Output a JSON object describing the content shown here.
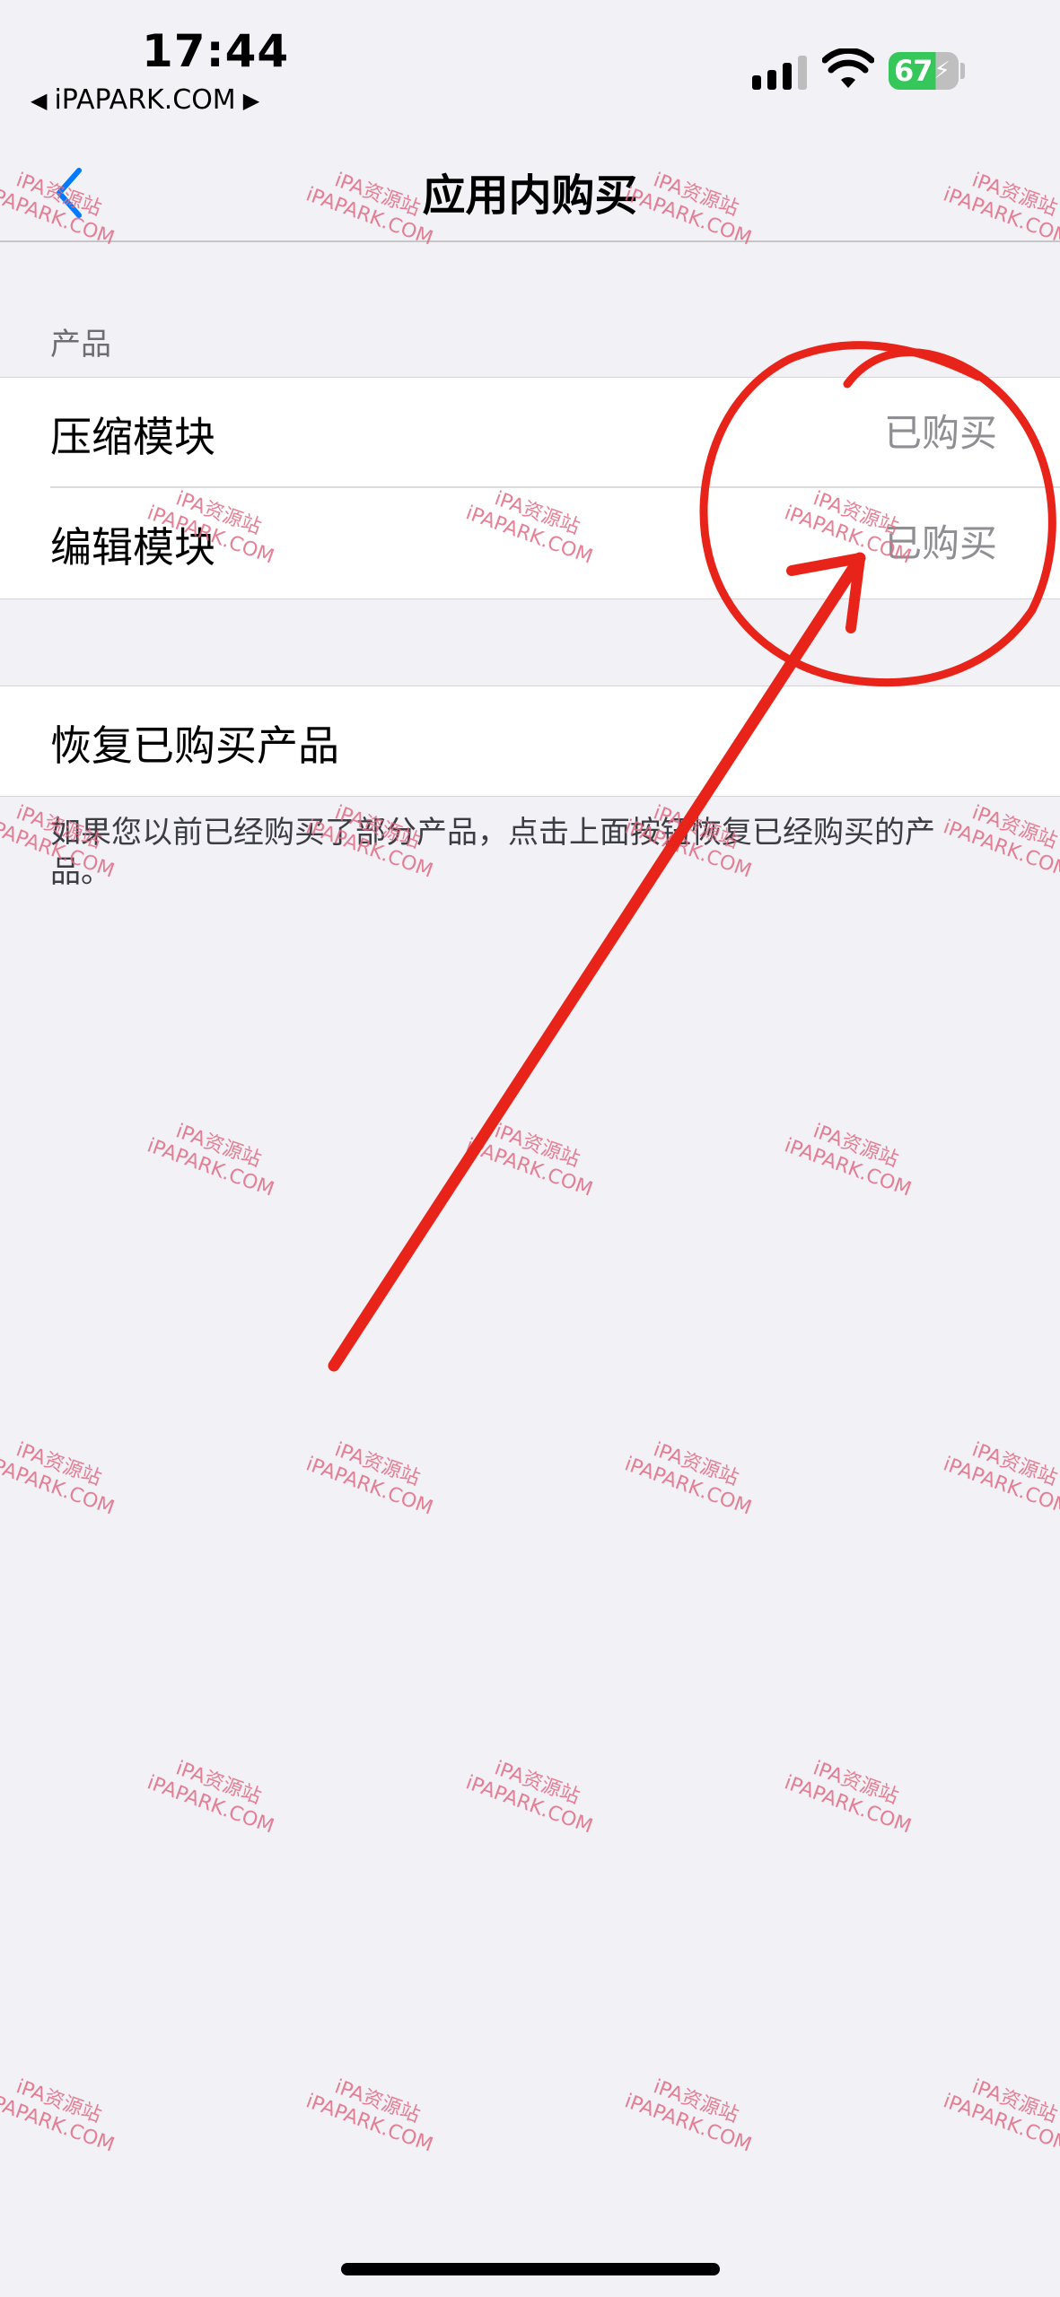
{
  "status_bar": {
    "time": "17:44",
    "back_app": "iPAPARK.COM",
    "battery_percent": "67",
    "battery_level": 0.67
  },
  "nav": {
    "title": "应用内购买"
  },
  "products_section": {
    "header": "产品",
    "items": [
      {
        "label": "压缩模块",
        "value": "已购买"
      },
      {
        "label": "编辑模块",
        "value": "已购买"
      }
    ]
  },
  "restore": {
    "label": "恢复已购买产品",
    "note": "如果您以前已经购买了部分产品，点击上面按钮恢复已经购买的产品。"
  },
  "watermark": {
    "line1": "iPA资源站",
    "line2": "iPAPARK.COM"
  },
  "colors": {
    "background": "#f2f1f6",
    "accent": "#007aff",
    "annotation": "#e8241a",
    "battery": "#35c759"
  }
}
